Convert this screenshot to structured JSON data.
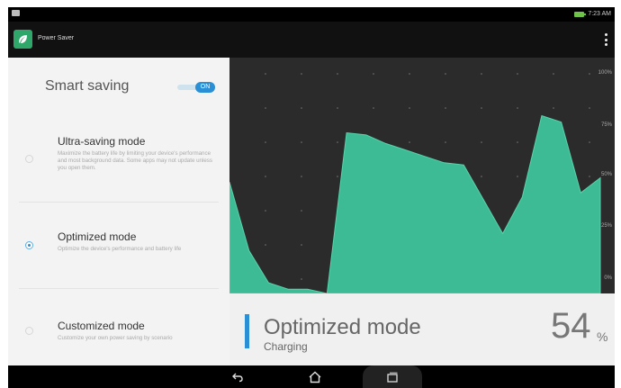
{
  "status_bar": {
    "time": "7:23 AM"
  },
  "app_bar": {
    "title": "Power Saver"
  },
  "smart_saving": {
    "label": "Smart saving",
    "toggle_label": "ON"
  },
  "modes": [
    {
      "title": "Ultra-saving mode",
      "description": "Maximize the battery life by limiting your device's performance and most background data. Some apps may not update unless you open them.",
      "selected": false
    },
    {
      "title": "Optimized mode",
      "description": "Optimize the device's performance and battery life",
      "selected": true
    },
    {
      "title": "Customized mode",
      "description": "Customize your own power saving by scenario",
      "selected": false
    }
  ],
  "chart_data": {
    "type": "area",
    "y_axis_labels": [
      "100%",
      "75%",
      "50%",
      "25%",
      "0%"
    ],
    "ylim": [
      0,
      100
    ],
    "grid": true,
    "color": "#3dbb95",
    "values": [
      52,
      20,
      5,
      2,
      2,
      0,
      75,
      74,
      70,
      67,
      64,
      61,
      60,
      44,
      28,
      45,
      83,
      80,
      47,
      54
    ]
  },
  "status": {
    "mode": "Optimized mode",
    "sub": "Charging",
    "percent": "54",
    "percent_sign": "%"
  },
  "colors": {
    "accent": "#2b8fd6",
    "chart_fill": "#3dbb95",
    "brand": "#2fa66a"
  }
}
